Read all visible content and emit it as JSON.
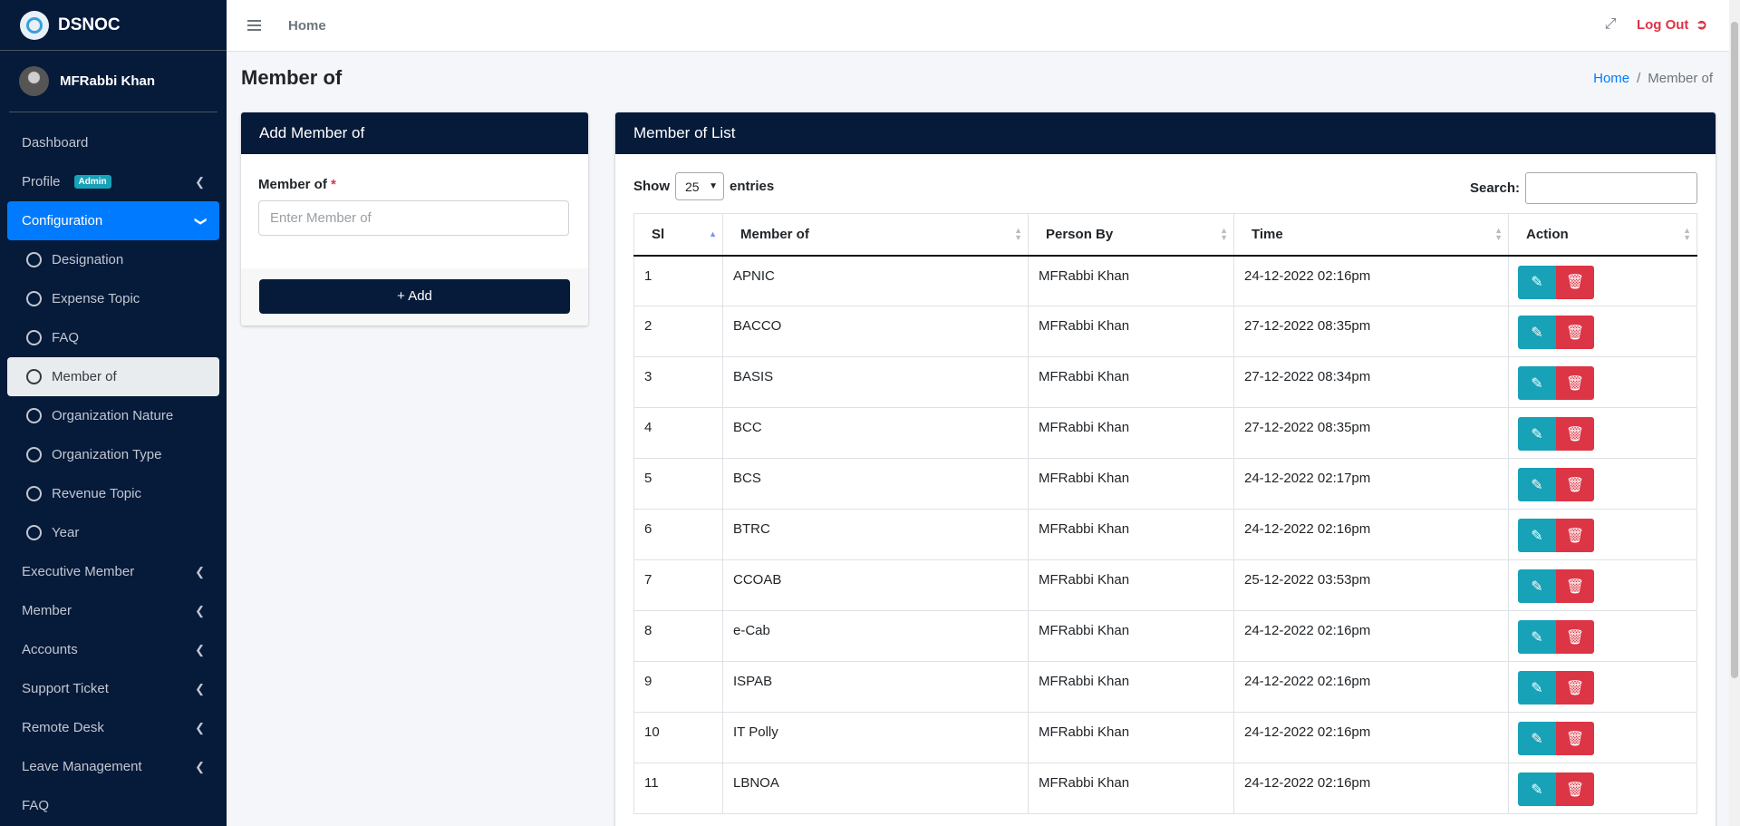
{
  "brand": {
    "name": "DSNOC"
  },
  "user": {
    "name": "MFRabbi Khan"
  },
  "sidebar": {
    "items": [
      {
        "label": "Dashboard"
      },
      {
        "label": "Profile",
        "badge": "Admin"
      },
      {
        "label": "Configuration"
      },
      {
        "label": "Executive Member"
      },
      {
        "label": "Member"
      },
      {
        "label": "Accounts"
      },
      {
        "label": "Support Ticket"
      },
      {
        "label": "Remote Desk"
      },
      {
        "label": "Leave Management"
      },
      {
        "label": "FAQ"
      }
    ],
    "config_sub": [
      {
        "label": "Designation"
      },
      {
        "label": "Expense Topic"
      },
      {
        "label": "FAQ"
      },
      {
        "label": "Member of"
      },
      {
        "label": "Organization Nature"
      },
      {
        "label": "Organization Type"
      },
      {
        "label": "Revenue Topic"
      },
      {
        "label": "Year"
      }
    ]
  },
  "topbar": {
    "home": "Home",
    "logout": "Log Out"
  },
  "page": {
    "title": "Member of",
    "breadcrumb": {
      "home": "Home",
      "sep": "/",
      "current": "Member of"
    }
  },
  "add_form": {
    "header": "Add Member of",
    "label": "Member of",
    "required_mark": "*",
    "placeholder": "Enter Member of",
    "button": "+ Add"
  },
  "list": {
    "header": "Member of List",
    "show_label": "Show",
    "entries_value": "25",
    "entries_label": "entries",
    "search_label": "Search:",
    "columns": [
      "Sl",
      "Member of",
      "Person By",
      "Time",
      "Action"
    ],
    "rows": [
      {
        "sl": "1",
        "member": "APNIC",
        "person": "MFRabbi Khan",
        "time": "24-12-2022 02:16pm"
      },
      {
        "sl": "2",
        "member": "BACCO",
        "person": "MFRabbi Khan",
        "time": "27-12-2022 08:35pm"
      },
      {
        "sl": "3",
        "member": "BASIS",
        "person": "MFRabbi Khan",
        "time": "27-12-2022 08:34pm"
      },
      {
        "sl": "4",
        "member": "BCC",
        "person": "MFRabbi Khan",
        "time": "27-12-2022 08:35pm"
      },
      {
        "sl": "5",
        "member": "BCS",
        "person": "MFRabbi Khan",
        "time": "24-12-2022 02:17pm"
      },
      {
        "sl": "6",
        "member": "BTRC",
        "person": "MFRabbi Khan",
        "time": "24-12-2022 02:16pm"
      },
      {
        "sl": "7",
        "member": "CCOAB",
        "person": "MFRabbi Khan",
        "time": "25-12-2022 03:53pm"
      },
      {
        "sl": "8",
        "member": "e-Cab",
        "person": "MFRabbi Khan",
        "time": "24-12-2022 02:16pm"
      },
      {
        "sl": "9",
        "member": "ISPAB",
        "person": "MFRabbi Khan",
        "time": "24-12-2022 02:16pm"
      },
      {
        "sl": "10",
        "member": "IT Polly",
        "person": "MFRabbi Khan",
        "time": "24-12-2022 02:16pm"
      },
      {
        "sl": "11",
        "member": "LBNOA",
        "person": "MFRabbi Khan",
        "time": "24-12-2022 02:16pm"
      }
    ]
  },
  "colors": {
    "navy": "#061a3a",
    "primary": "#007bff",
    "info": "#17a2b8",
    "danger": "#dc3545"
  },
  "icons": {
    "edit": "edit-icon",
    "delete": "trash-icon",
    "fullscreen": "expand-icon",
    "logout": "sign-out-icon",
    "menu": "hamburger-icon"
  }
}
